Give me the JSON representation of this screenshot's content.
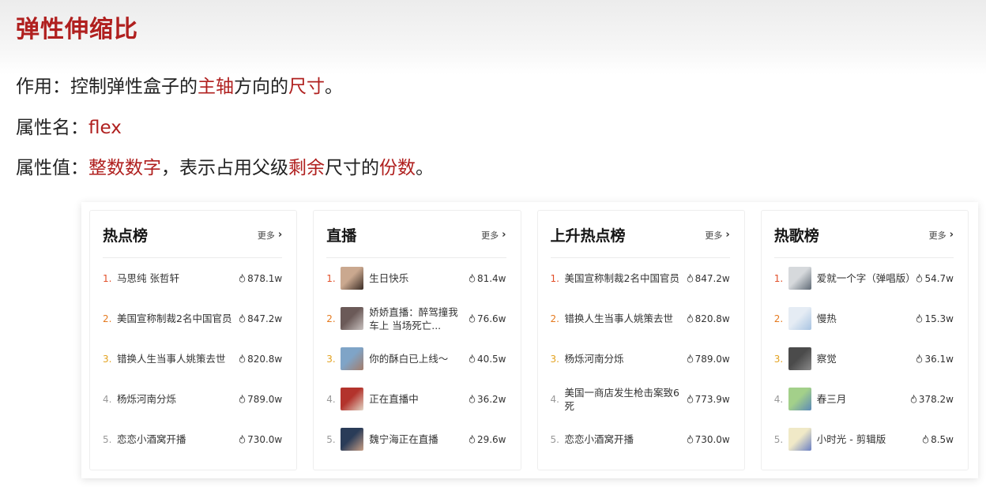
{
  "heading": "弹性伸缩比",
  "line1": {
    "a": "作用：控制弹性盒子的",
    "b": "主轴",
    "c": "方向的",
    "d": "尺寸",
    "e": "。"
  },
  "line2": {
    "a": "属性名：",
    "b": "flex"
  },
  "line3": {
    "a": "属性值：",
    "b": "整数数字",
    "c": "，表示占用父级",
    "d": "剩余",
    "e": "尺寸的",
    "f": "份数",
    "g": "。"
  },
  "colors": {
    "accent": "#b0201f",
    "rank1": "#e2502a",
    "rank2": "#e57a1f",
    "rank3": "#e3a21f"
  },
  "panels": [
    {
      "title": "热点榜",
      "more": "更多",
      "items": [
        {
          "rank": "1.",
          "name": "马思纯 张哲轩",
          "value": "878.1w"
        },
        {
          "rank": "2.",
          "name": "美国宣称制裁2名中国官员",
          "value": "847.2w"
        },
        {
          "rank": "3.",
          "name": "错换人生当事人姚策去世",
          "value": "820.8w"
        },
        {
          "rank": "4.",
          "name": "杨烁河南分烁",
          "value": "789.0w"
        },
        {
          "rank": "5.",
          "name": "恋恋小酒窝开播",
          "value": "730.0w"
        }
      ]
    },
    {
      "title": "直播",
      "more": "更多",
      "items": [
        {
          "rank": "1.",
          "name": "生日快乐",
          "value": "81.4w",
          "thumb": "avatar"
        },
        {
          "rank": "2.",
          "name": "娇娇直播：醉驾撞我车上 当场死亡...",
          "value": "76.6w",
          "thumb": "avatar"
        },
        {
          "rank": "3.",
          "name": "你的酥白已上线～",
          "value": "40.5w",
          "thumb": "avatar"
        },
        {
          "rank": "4.",
          "name": "正在直播中",
          "value": "36.2w",
          "thumb": "avatar"
        },
        {
          "rank": "5.",
          "name": "魏宁海正在直播",
          "value": "29.6w",
          "thumb": "avatar"
        }
      ]
    },
    {
      "title": "上升热点榜",
      "more": "更多",
      "items": [
        {
          "rank": "1.",
          "name": "美国宣称制裁2名中国官员",
          "value": "847.2w"
        },
        {
          "rank": "2.",
          "name": "错换人生当事人姚策去世",
          "value": "820.8w"
        },
        {
          "rank": "3.",
          "name": "杨烁河南分烁",
          "value": "789.0w"
        },
        {
          "rank": "4.",
          "name": "美国一商店发生枪击案致6死",
          "value": "773.9w"
        },
        {
          "rank": "5.",
          "name": "恋恋小酒窝开播",
          "value": "730.0w"
        }
      ]
    },
    {
      "title": "热歌榜",
      "more": "更多",
      "items": [
        {
          "rank": "1.",
          "name": "爱就一个字（弹唱版）",
          "value": "54.7w",
          "thumb": "album"
        },
        {
          "rank": "2.",
          "name": "慢热",
          "value": "15.3w",
          "thumb": "album"
        },
        {
          "rank": "3.",
          "name": "察觉",
          "value": "36.1w",
          "thumb": "album"
        },
        {
          "rank": "4.",
          "name": "春三月",
          "value": "378.2w",
          "thumb": "album"
        },
        {
          "rank": "5.",
          "name": "小时光 - 剪辑版",
          "value": "8.5w",
          "thumb": "album"
        }
      ]
    }
  ]
}
